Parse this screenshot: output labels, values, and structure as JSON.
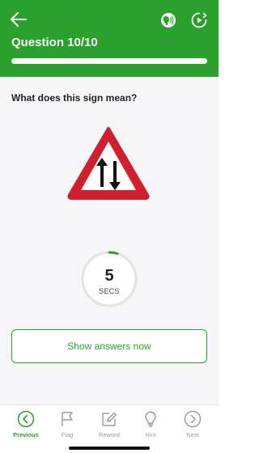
{
  "header": {
    "title": "Question 10/10",
    "progress": 1.0,
    "back_icon": "arrow-left-icon",
    "speech_icon": "speech-icon",
    "play_icon": "play-circle-icon"
  },
  "question": {
    "text": "What does this sign mean?",
    "sign_icon": "two-way-traffic-sign"
  },
  "timer": {
    "value": "5",
    "unit": "SECS"
  },
  "actions": {
    "show_answers": "Show answers now"
  },
  "bottom_nav": {
    "items": [
      {
        "label": "Previous",
        "icon": "chevron-left-circle-icon",
        "active": true
      },
      {
        "label": "Flag",
        "icon": "flag-icon",
        "active": false
      },
      {
        "label": "Reword",
        "icon": "edit-icon",
        "active": false
      },
      {
        "label": "Hint",
        "icon": "lightbulb-icon",
        "active": false
      },
      {
        "label": "Next",
        "icon": "chevron-right-circle-icon",
        "active": false
      }
    ]
  },
  "colors": {
    "brand_green": "#2aa12d",
    "sign_red": "#d0202e",
    "inactive_gray": "#9a9a9a"
  }
}
